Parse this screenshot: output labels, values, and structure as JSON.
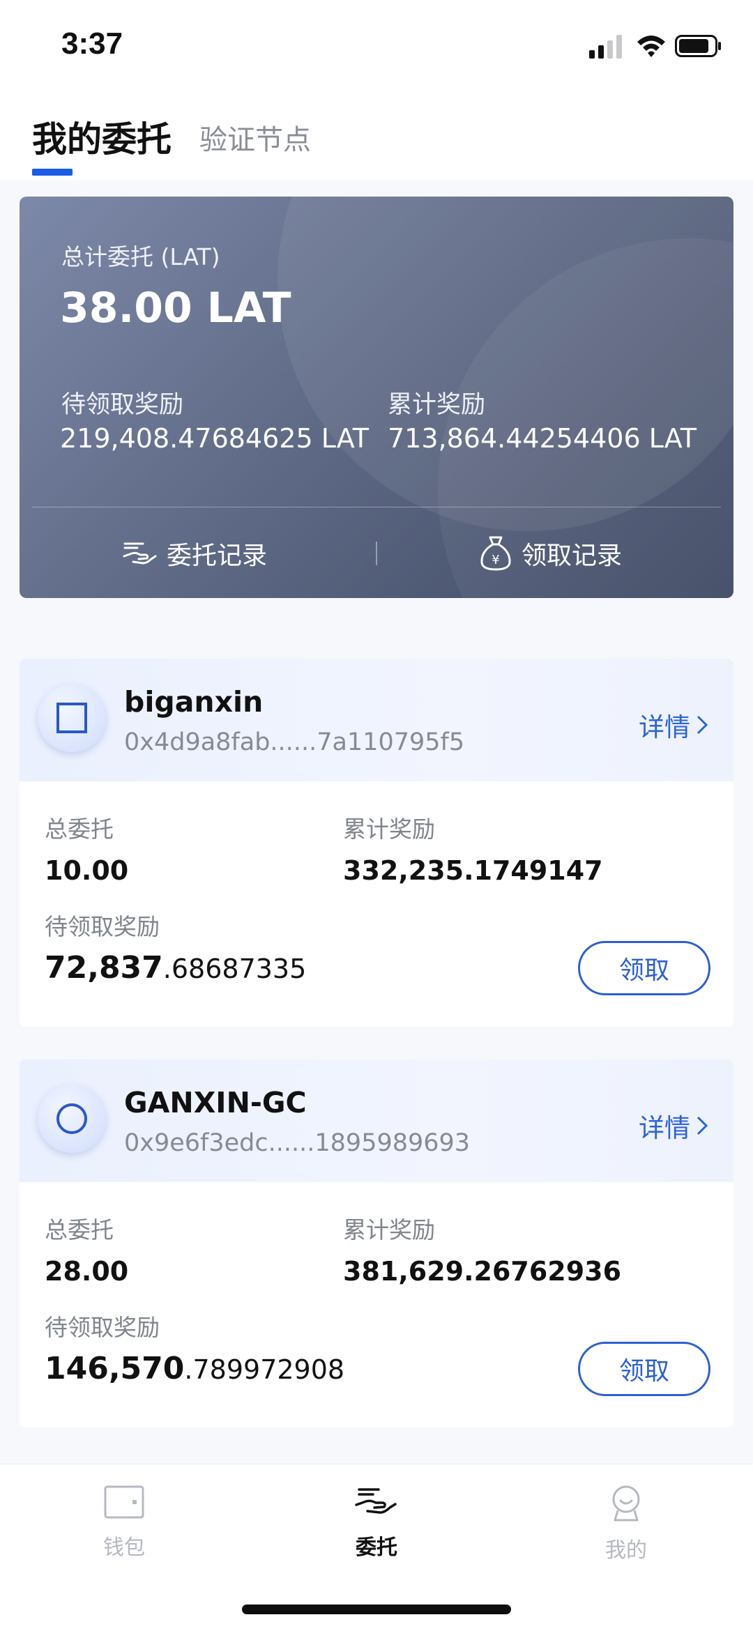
{
  "status_bar": {
    "time": "3:37"
  },
  "tabs": {
    "active": "我的委托",
    "inactive": "验证节点"
  },
  "summary": {
    "total_label": "总计委托 (LAT)",
    "total_value": "38.00 LAT",
    "pending_label": "待领取奖励",
    "pending_value": "219,408.47684625 LAT",
    "cumulative_label": "累计奖励",
    "cumulative_value": "713,864.44254406 LAT",
    "delegate_records": "委托记录",
    "claim_records": "领取记录"
  },
  "delegations": [
    {
      "name": "biganxin",
      "address": "0x4d9a8fab......7a110795f5",
      "detail": "详情",
      "total_label": "总委托",
      "total_value": "10.00",
      "cumulative_label": "累计奖励",
      "cumulative_value": "332,235.1749147",
      "pending_label": "待领取奖励",
      "pending_int": "72,837",
      "pending_frac": ".68687335",
      "claim": "领取",
      "avatar_icon": "square-icon"
    },
    {
      "name": "GANXIN-GC",
      "address": "0x9e6f3edc......1895989693",
      "detail": "详情",
      "total_label": "总委托",
      "total_value": "28.00",
      "cumulative_label": "累计奖励",
      "cumulative_value": "381,629.26762936",
      "pending_label": "待领取奖励",
      "pending_int": "146,570",
      "pending_frac": ".789972908",
      "claim": "领取",
      "avatar_icon": "circle-icon"
    }
  ],
  "nav": [
    {
      "label": "钱包",
      "icon": "wallet-icon",
      "active": false
    },
    {
      "label": "委托",
      "icon": "delegate-icon",
      "active": true
    },
    {
      "label": "我的",
      "icon": "profile-icon",
      "active": false
    }
  ],
  "colors": {
    "accent": "#2c5fd4",
    "card_dark": "#4a5470"
  }
}
